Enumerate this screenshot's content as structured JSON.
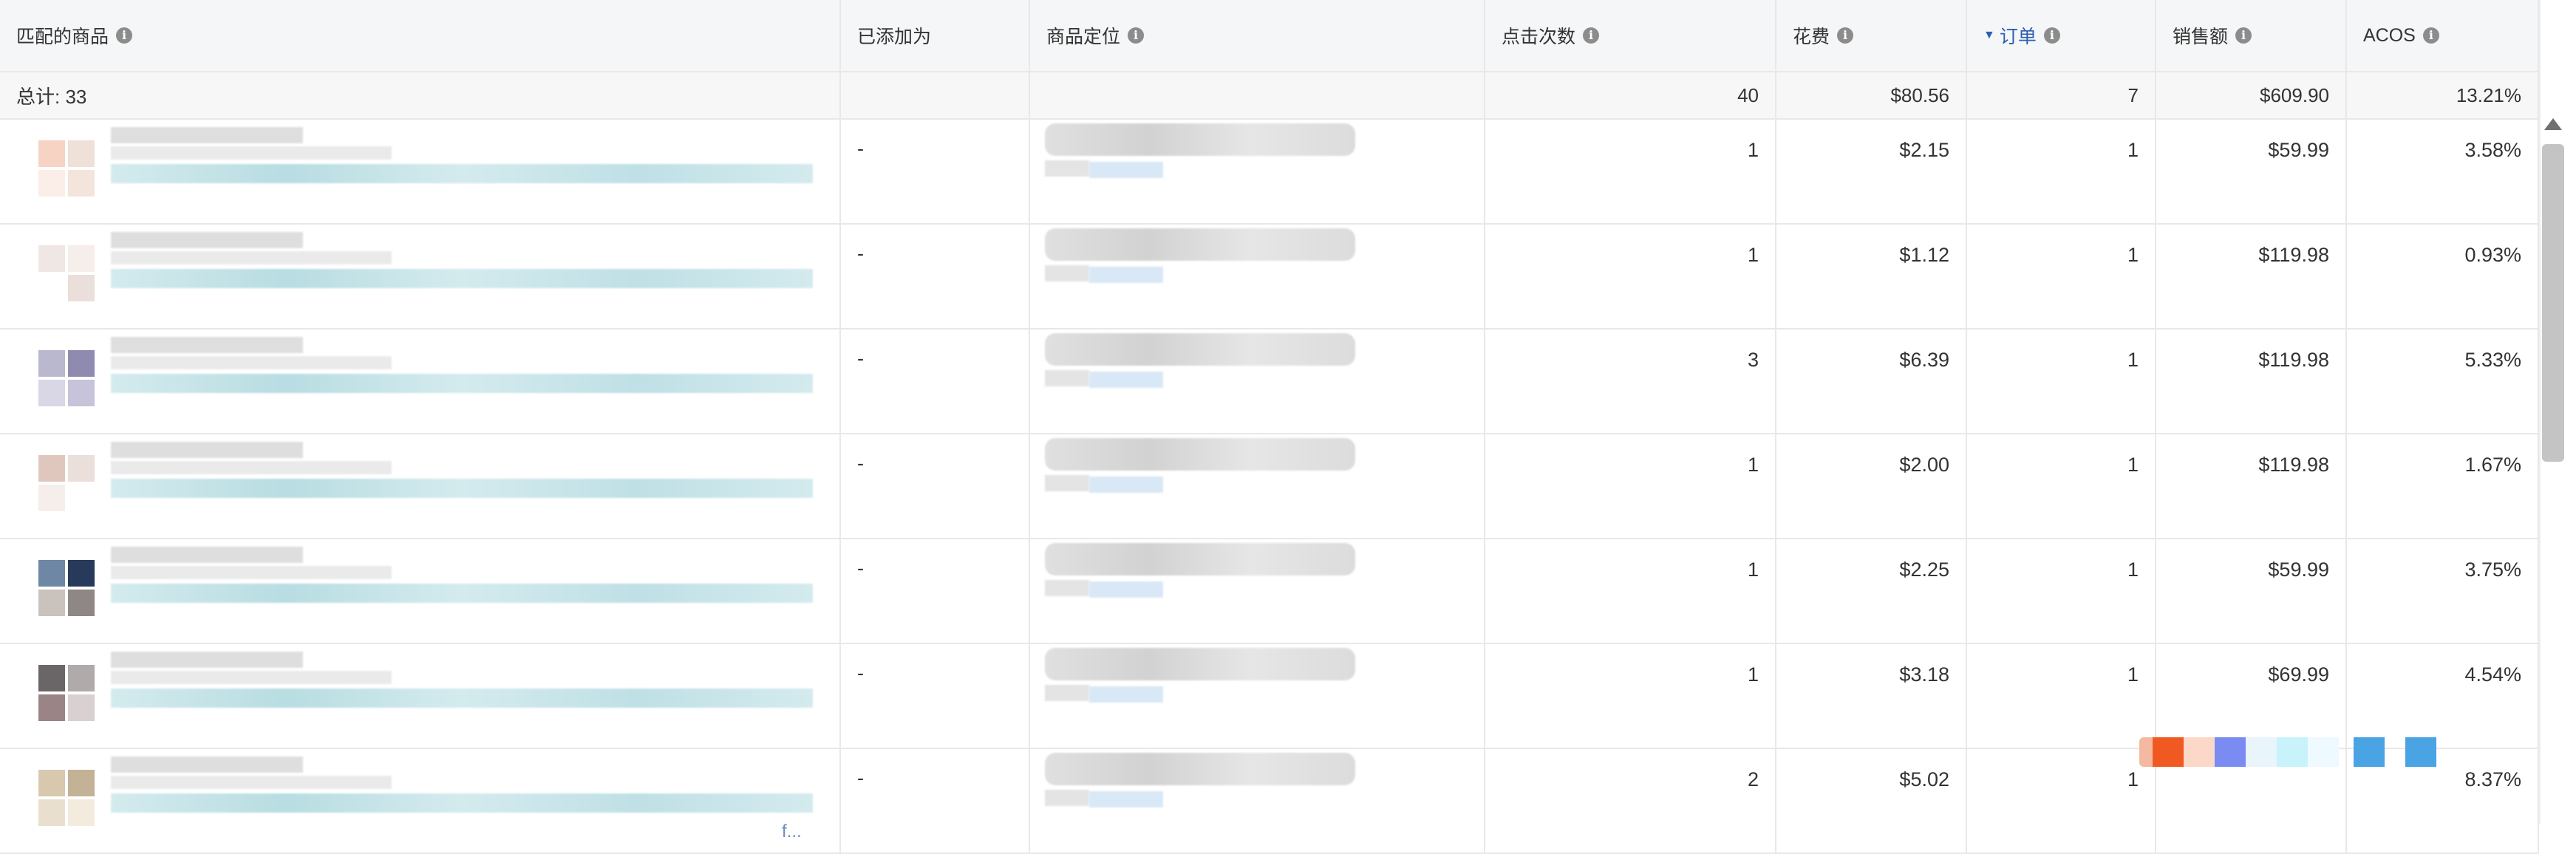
{
  "columns": [
    {
      "key": "matched_product",
      "label": "匹配的商品",
      "info": true
    },
    {
      "key": "added_as",
      "label": "已添加为",
      "info": false
    },
    {
      "key": "product_targeting",
      "label": "商品定位",
      "info": true
    },
    {
      "key": "clicks",
      "label": "点击次数",
      "info": true
    },
    {
      "key": "spend",
      "label": "花费",
      "info": true
    },
    {
      "key": "orders",
      "label": "订单",
      "info": true,
      "sorted": true
    },
    {
      "key": "sales",
      "label": "销售额",
      "info": true
    },
    {
      "key": "acos",
      "label": "ACOS",
      "info": true
    }
  ],
  "total": {
    "label": "总计: 33",
    "clicks": "40",
    "spend": "$80.56",
    "orders": "7",
    "sales": "$609.90",
    "acos": "13.21%"
  },
  "rows": [
    {
      "added_as": "-",
      "clicks": "1",
      "spend": "$2.15",
      "orders": "1",
      "sales": "$59.99",
      "acos": "3.58%"
    },
    {
      "added_as": "-",
      "clicks": "1",
      "spend": "$1.12",
      "orders": "1",
      "sales": "$119.98",
      "acos": "0.93%"
    },
    {
      "added_as": "-",
      "clicks": "3",
      "spend": "$6.39",
      "orders": "1",
      "sales": "$119.98",
      "acos": "5.33%"
    },
    {
      "added_as": "-",
      "clicks": "1",
      "spend": "$2.00",
      "orders": "1",
      "sales": "$119.98",
      "acos": "1.67%"
    },
    {
      "added_as": "-",
      "clicks": "1",
      "spend": "$2.25",
      "orders": "1",
      "sales": "$59.99",
      "acos": "3.75%"
    },
    {
      "added_as": "-",
      "clicks": "1",
      "spend": "$3.18",
      "orders": "1",
      "sales": "$69.99",
      "acos": "4.54%"
    },
    {
      "added_as": "-",
      "clicks": "2",
      "spend": "$5.02",
      "orders": "1",
      "sales": "",
      "acos": "8.37%"
    }
  ],
  "truncation": "f...",
  "info_glyph": "i",
  "sort_glyph": "▼",
  "colors": {
    "sort_accent": "#2b5fb4",
    "border": "#e8e8e8",
    "header_bg": "#f5f6f7"
  }
}
